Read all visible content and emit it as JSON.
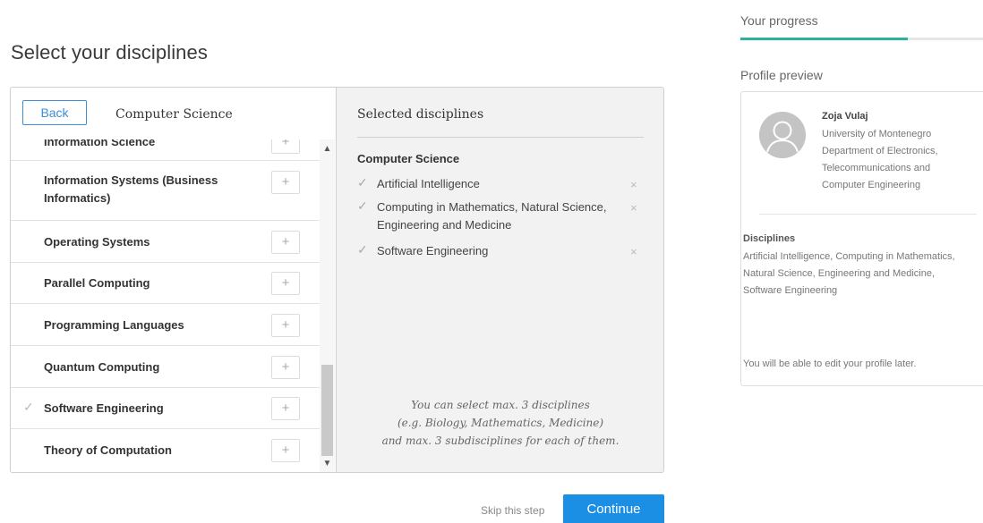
{
  "page": {
    "title": "Select your disciplines"
  },
  "left": {
    "back_label": "Back",
    "heading": "Computer Science",
    "items": [
      {
        "label": "Information Science",
        "checked": false
      },
      {
        "label": "Information Systems (Business Informatics)",
        "checked": false
      },
      {
        "label": "Operating Systems",
        "checked": false
      },
      {
        "label": "Parallel Computing",
        "checked": false
      },
      {
        "label": "Programming Languages",
        "checked": false
      },
      {
        "label": "Quantum Computing",
        "checked": false
      },
      {
        "label": "Software Engineering",
        "checked": true
      },
      {
        "label": "Theory of Computation",
        "checked": false
      }
    ],
    "add_glyph": "+",
    "check_glyph": "✓"
  },
  "selected": {
    "heading": "Selected disciplines",
    "group": "Computer Science",
    "items": [
      "Artificial Intelligence",
      "Computing in Mathematics, Natural Science, Engineering and Medicine",
      "Software Engineering"
    ],
    "remove_glyph": "×",
    "note_lines": [
      "You can select max. 3 disciplines",
      "(e.g. Biology, Mathematics, Medicine)",
      "and max. 3 subdisciplines for each of them."
    ]
  },
  "actions": {
    "skip_label": "Skip this step",
    "continue_label": "Continue"
  },
  "progress": {
    "label": "Your progress",
    "fraction": 0.69,
    "color": "#2cb39a"
  },
  "preview": {
    "label": "Profile preview",
    "name": "Zoja Vulaj",
    "affiliation_lines": [
      "University of Montenegro",
      "Department of Electronics,",
      "Telecommunications and",
      "Computer Engineering"
    ],
    "disciplines_title": "Disciplines",
    "disciplines_text": "Artificial Intelligence, Computing in Mathematics, Natural Science, Engineering and Medicine, Software Engineering",
    "edit_note": "You will be able to edit your profile later."
  },
  "colors": {
    "accent": "#1a8fe3",
    "progress": "#2cb39a"
  },
  "icons": {
    "avatar": "user-avatar-icon",
    "plus": "plus-icon",
    "check": "check-icon",
    "remove": "close-icon"
  }
}
